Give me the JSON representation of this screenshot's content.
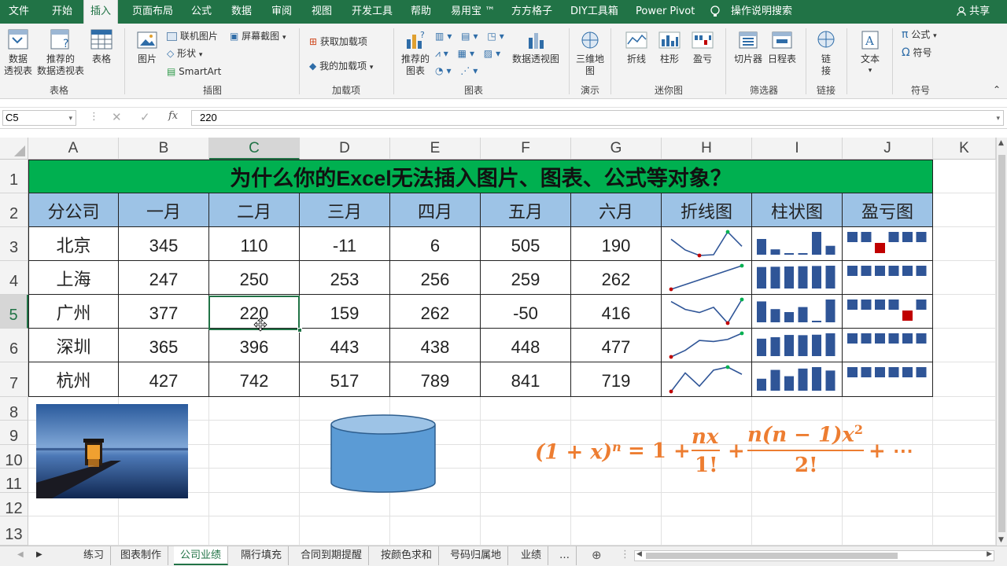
{
  "menu": {
    "tabs": [
      "文件",
      "开始",
      "插入",
      "页面布局",
      "公式",
      "数据",
      "审阅",
      "视图",
      "开发工具",
      "帮助",
      "易用宝 ™",
      "方方格子",
      "DIY工具箱",
      "Power Pivot"
    ],
    "active_tab": "插入",
    "tell_me": "操作说明搜索",
    "share": "共享"
  },
  "ribbon": {
    "pivot_table": "数据\n透视表",
    "recommended_pivot": "推荐的\n数据透视表",
    "table": "表格",
    "group_tables": "表格",
    "picture": "图片",
    "online_picture": "联机图片",
    "shapes": "形状",
    "smartart": "SmartArt",
    "screenshot": "屏幕截图",
    "group_illustrations": "插图",
    "get_addins": "获取加载项",
    "my_addins": "我的加载项",
    "group_addins": "加载项",
    "recommended_charts": "推荐的\n图表",
    "pivot_chart": "数据透视图",
    "group_charts": "图表",
    "map3d": "三维地\n图",
    "group_tours": "演示",
    "spark_line": "折线",
    "spark_column": "柱形",
    "spark_winloss": "盈亏",
    "group_sparklines": "迷你图",
    "slicer": "切片器",
    "timeline": "日程表",
    "group_filters": "筛选器",
    "link": "链\n接",
    "group_links": "链接",
    "text": "文本",
    "equation": "公式",
    "symbol": "符号",
    "group_symbols": "符号"
  },
  "formula_bar": {
    "name_box": "C5",
    "fx": "fx",
    "value": "220"
  },
  "columns": [
    "A",
    "B",
    "C",
    "D",
    "E",
    "F",
    "G",
    "H",
    "I",
    "J",
    "K"
  ],
  "rows": [
    "1",
    "2",
    "3",
    "4",
    "5",
    "6",
    "7",
    "8",
    "9",
    "10",
    "11",
    "12",
    "13"
  ],
  "sheet": {
    "title": "为什么你的Excel无法插入图片、图表、公式等对象？",
    "headers": [
      "分公司",
      "一月",
      "二月",
      "三月",
      "四月",
      "五月",
      "六月",
      "折线图",
      "柱状图",
      "盈亏图"
    ],
    "data": [
      {
        "city": "北京",
        "values": [
          345,
          110,
          -11,
          6,
          505,
          190
        ]
      },
      {
        "city": "上海",
        "values": [
          247,
          250,
          253,
          256,
          259,
          262
        ]
      },
      {
        "city": "广州",
        "values": [
          377,
          220,
          159,
          262,
          -50,
          416
        ]
      },
      {
        "city": "深圳",
        "values": [
          365,
          396,
          443,
          438,
          448,
          477
        ]
      },
      {
        "city": "杭州",
        "values": [
          427,
          742,
          517,
          789,
          841,
          719
        ]
      }
    ],
    "formula_text": "(1 + x)ⁿ = 1 + nx/1! + n(n − 1)x²/2! + ⋯",
    "formula": {
      "lhs": "(1 + x)",
      "n": "n",
      "eq": "= 1 +",
      "f1_num": "nx",
      "f1_den": "1!",
      "plus": "+",
      "f2_num": "n(n − 1)x",
      "sq": "2",
      "f2_den": "2!",
      "tail": "+ ⋯"
    }
  },
  "colors": {
    "excel_green": "#217346",
    "title_fill": "#00b050",
    "header_fill": "#9dc3e6",
    "spark_line": "#2f5597",
    "spark_high": "#00b050",
    "spark_low": "#c00000",
    "column_bar": "#2f5597",
    "loss": "#c00000",
    "formula": "#ed7d31",
    "cylinder": "#5b9bd5"
  },
  "sheet_tabs": [
    "练习",
    "图表制作",
    "公司业绩",
    "隔行填充",
    "合同到期提醒",
    "按颜色求和",
    "号码归属地",
    "业绩",
    "…"
  ],
  "active_sheet": "公司业绩"
}
